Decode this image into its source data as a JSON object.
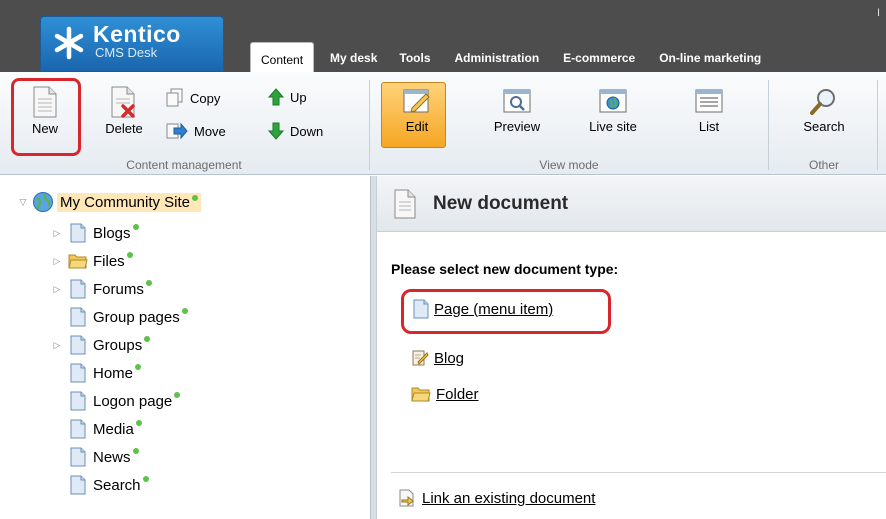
{
  "logo": {
    "title": "Kentico",
    "subtitle": "CMS Desk"
  },
  "topbar": {
    "corner_text": "I"
  },
  "tabs": [
    {
      "label": "Content"
    },
    {
      "label": "My desk"
    },
    {
      "label": "Tools"
    },
    {
      "label": "Administration"
    },
    {
      "label": "E-commerce"
    },
    {
      "label": "On-line marketing"
    }
  ],
  "ribbon": {
    "content_management": {
      "label": "Content management",
      "new": "New",
      "delete": "Delete",
      "copy": "Copy",
      "move": "Move",
      "up": "Up",
      "down": "Down"
    },
    "view_mode": {
      "label": "View mode",
      "edit": "Edit",
      "preview": "Preview",
      "live_site": "Live site",
      "list": "List"
    },
    "other": {
      "label": "Other",
      "search": "Search"
    }
  },
  "tree": {
    "root": "My Community Site",
    "items": [
      {
        "label": "Blogs"
      },
      {
        "label": "Files"
      },
      {
        "label": "Forums"
      },
      {
        "label": "Group pages"
      },
      {
        "label": "Groups"
      },
      {
        "label": "Home"
      },
      {
        "label": "Logon page"
      },
      {
        "label": "Media"
      },
      {
        "label": "News"
      },
      {
        "label": "Search"
      }
    ]
  },
  "content": {
    "title": "New document",
    "select_label": "Please select new document type:",
    "doc_types": [
      {
        "label": "Page (menu item)"
      },
      {
        "label": "Blog"
      },
      {
        "label": "Folder"
      }
    ],
    "link_existing": "Link an existing document"
  },
  "colors": {
    "highlight": "#d8262c",
    "publish_dot": "#5cc24a",
    "edit_active": "#f5a623",
    "logo_blue": "#1a66ad"
  }
}
